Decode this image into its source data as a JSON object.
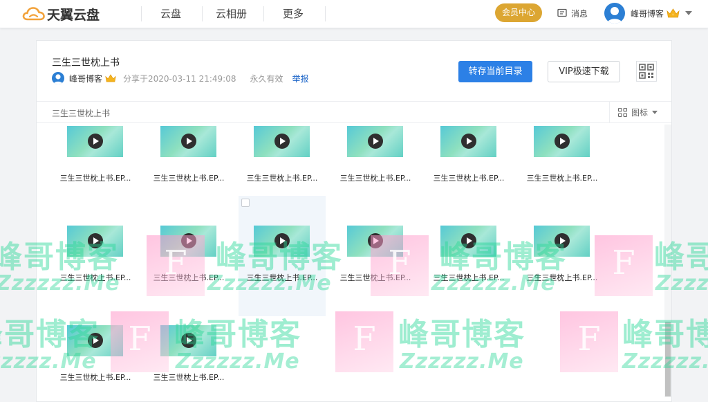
{
  "brand": {
    "name": "天翼云盘",
    "accent": "#f2a23a"
  },
  "nav": {
    "items": [
      {
        "label": "云盘"
      },
      {
        "label": "云相册"
      },
      {
        "label": "更多"
      }
    ],
    "vip_center": "会员中心",
    "messages": "消息",
    "user_name": "峰哥博客"
  },
  "share": {
    "title": "三生三世枕上书",
    "sharer": "峰哥博客",
    "shared_at": "分享于2020-03-11 21:49:08",
    "validity": "永久有效",
    "report": "举报",
    "save_button": "转存当前目录",
    "vip_download_button": "VIP极速下载"
  },
  "toolbar": {
    "breadcrumb": "三生三世枕上书",
    "view_mode": "图标"
  },
  "files": [
    {
      "name": "三生三世枕上书.EP..."
    },
    {
      "name": "三生三世枕上书.EP..."
    },
    {
      "name": "三生三世枕上书.EP..."
    },
    {
      "name": "三生三世枕上书.EP..."
    },
    {
      "name": "三生三世枕上书.EP..."
    },
    {
      "name": "三生三世枕上书.EP..."
    },
    {
      "name": "三生三世枕上书.EP..."
    },
    {
      "name": "三生三世枕上书.EP..."
    },
    {
      "name": "三生三世枕上书.EP..."
    },
    {
      "name": "三生三世枕上书.EP..."
    },
    {
      "name": "三生三世枕上书.EP..."
    },
    {
      "name": "三生三世枕上书.EP..."
    },
    {
      "name": "三生三世枕上书.EP..."
    },
    {
      "name": "三生三世枕上书.EP..."
    }
  ],
  "watermark": {
    "letter": "F",
    "cn": "峰哥博客",
    "en": "Zzzzzz.Me"
  },
  "colors": {
    "primary_button": "#2c80e6",
    "vip_badge": "#dca632",
    "link": "#1b64c8"
  },
  "icons": [
    "cloud-logo-icon",
    "message-icon",
    "avatar",
    "crown-icon",
    "chevron-down-icon",
    "qr-code-icon",
    "grid-view-icon",
    "play-icon",
    "checkbox"
  ]
}
